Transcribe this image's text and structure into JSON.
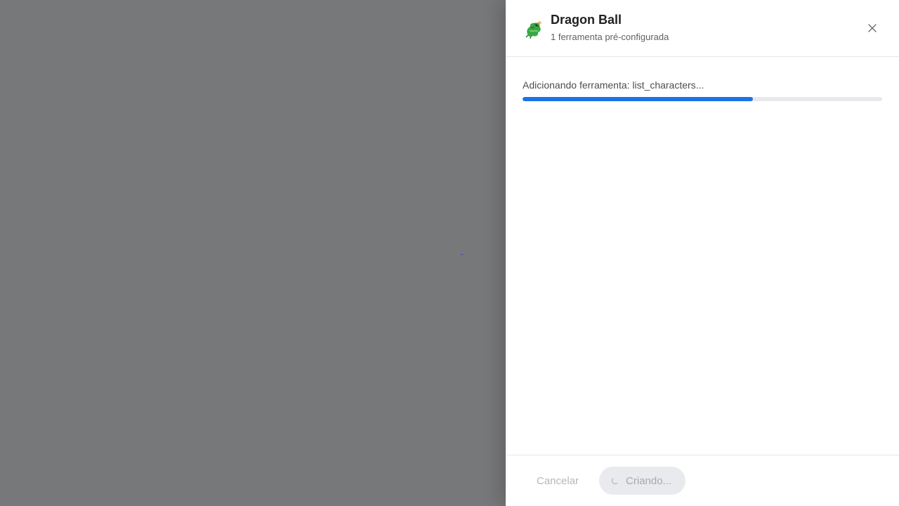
{
  "drawer": {
    "icon": "dragon-icon",
    "title": "Dragon Ball",
    "subtitle": "1 ferramenta pré-configurada",
    "close_icon": "close-icon"
  },
  "progress": {
    "label": "Adicionando ferramenta: list_characters...",
    "percent": 64,
    "color": "#1a73e8"
  },
  "footer": {
    "cancel_label": "Cancelar",
    "create_label": "Criando...",
    "create_icon": "spinner-icon"
  }
}
